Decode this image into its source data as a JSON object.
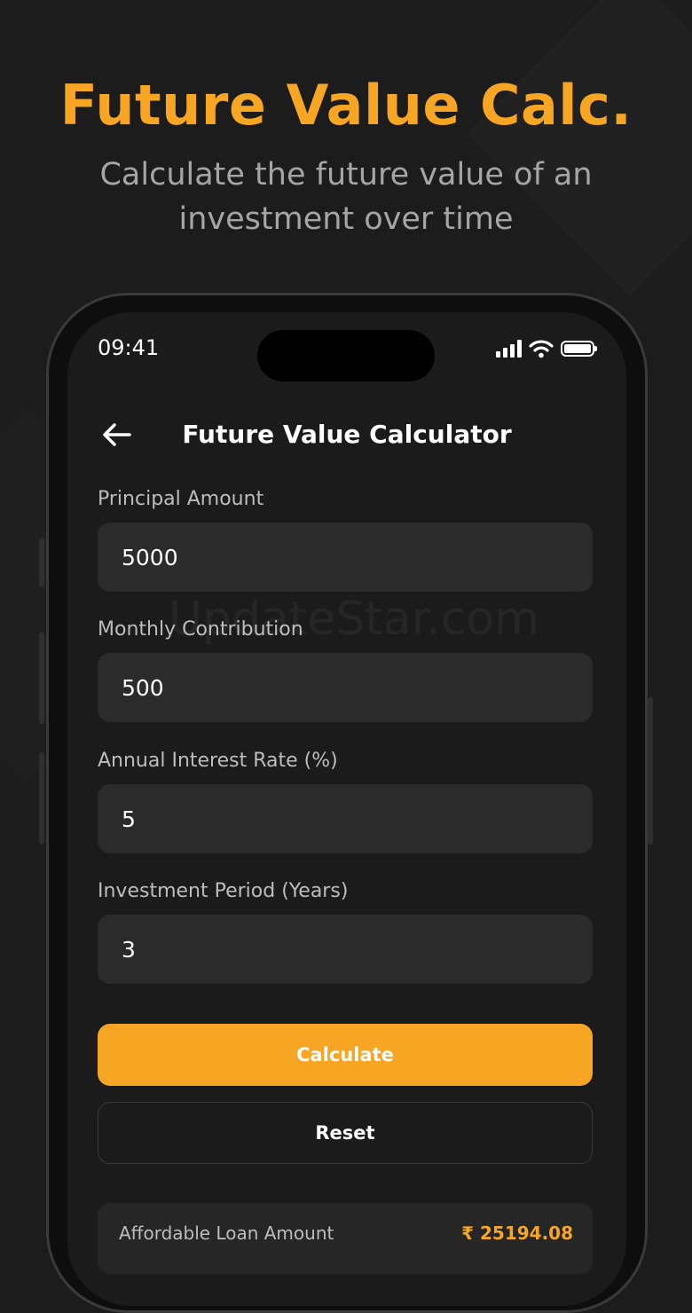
{
  "hero": {
    "title": "Future Value Calc.",
    "subtitle": "Calculate the future value of an investment over time"
  },
  "status_bar": {
    "time": "09:41",
    "icons": [
      "signal-icon",
      "wifi-icon",
      "battery-icon"
    ]
  },
  "nav": {
    "back_icon": "arrow-left-icon",
    "title": "Future Value Calculator"
  },
  "form": {
    "principal": {
      "label": "Principal Amount",
      "value": "5000"
    },
    "monthly": {
      "label": "Monthly Contribution",
      "value": "500"
    },
    "rate": {
      "label": "Annual Interest Rate (%)",
      "value": "5"
    },
    "period": {
      "label": "Investment Period (Years)",
      "value": "3"
    }
  },
  "actions": {
    "calculate_label": "Calculate",
    "reset_label": "Reset"
  },
  "result": {
    "label": "Affordable Loan Amount",
    "value": "₹ 25194.08"
  },
  "watermark": "UpdateStar.com",
  "colors": {
    "accent": "#f6a623",
    "background": "#1c1c1c",
    "input_bg": "#2b2b2b"
  }
}
